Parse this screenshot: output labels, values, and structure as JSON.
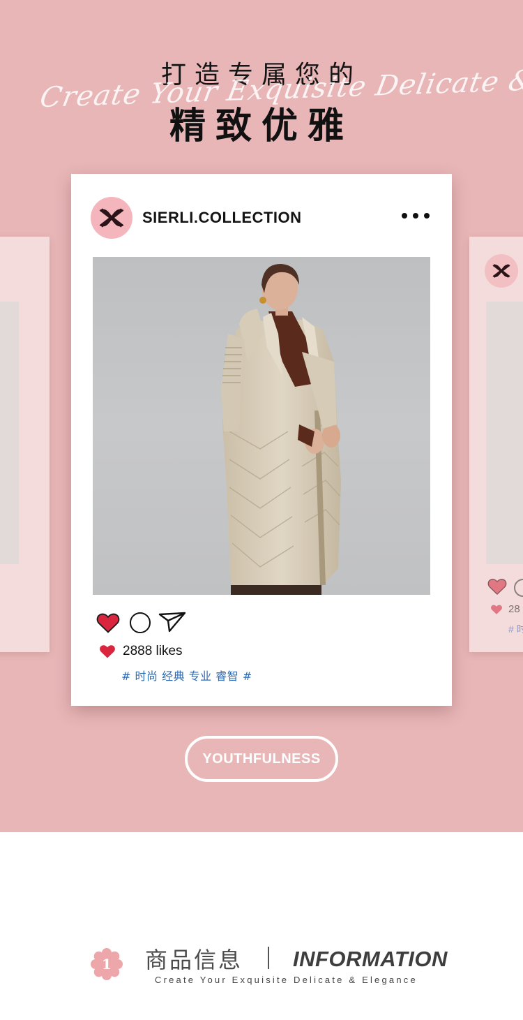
{
  "hero": {
    "headline_top": "打造专属您的",
    "script_tagline": "Create Your Exquisite Delicate & Elegance",
    "headline_main": "精致优雅"
  },
  "post": {
    "username": "SIERLI.COLLECTION",
    "likes": "2888 likes",
    "hashtags": "# 时尚 经典 专业 睿智 #",
    "photo": "model-in-long-cream-down-coat"
  },
  "side_card_right": {
    "likes_partial": "28",
    "tags_partial": "# 时"
  },
  "badge_label": "YOUTHFULNESS",
  "section": {
    "number": "1",
    "title_cn": "商品信息",
    "separator": "|",
    "title_en": "INFORMATION",
    "subtitle": "Create Your Exquisite Delicate & Elegance"
  },
  "icons": {
    "avatar": "brand-logo-icon",
    "menu": "more-dots-icon",
    "like": "heart-icon",
    "comment": "comment-icon",
    "share": "send-icon"
  },
  "colors": {
    "hero_background": "#e8b6b7",
    "avatar_pink": "#f4b6bc",
    "heart_red": "#d9263e",
    "hashtag_blue": "#2d6bb5",
    "card_background": "#ffffff"
  }
}
